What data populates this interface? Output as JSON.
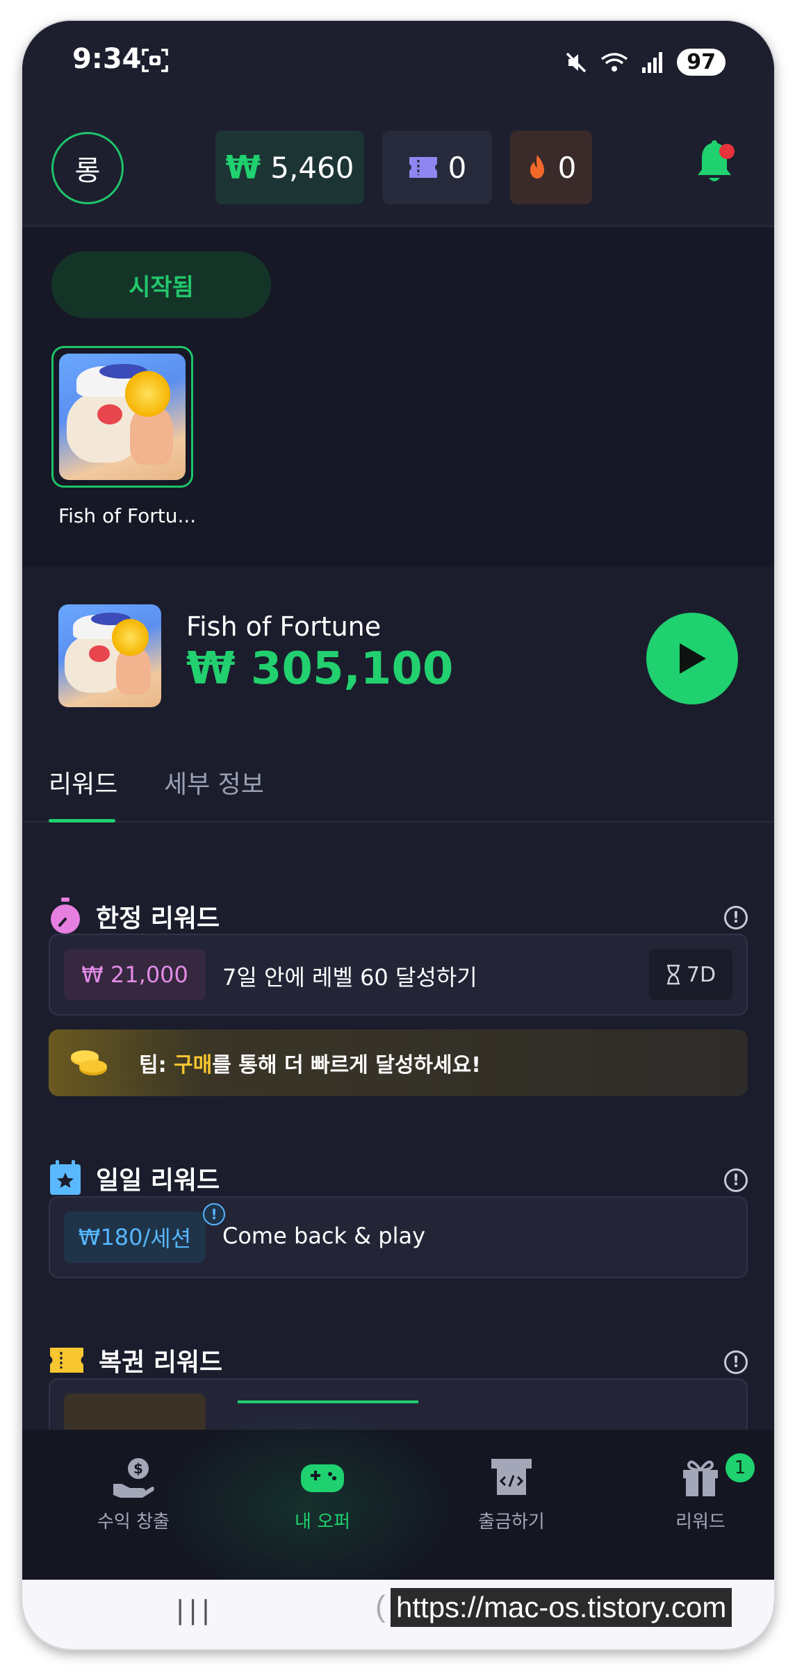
{
  "status": {
    "time": "9:34",
    "battery": "97"
  },
  "header": {
    "avatar_text": "롱",
    "coins": {
      "symbol": "₩",
      "value": "5,460"
    },
    "tickets": "0",
    "fire": "0"
  },
  "started": {
    "label": "시작됨",
    "games": [
      {
        "name": "Fish of Fortu..."
      }
    ]
  },
  "game": {
    "name": "Fish of Fortune",
    "currency": "₩",
    "amount": "305,100"
  },
  "tabs": [
    {
      "label": "리워드",
      "active": true
    },
    {
      "label": "세부 정보",
      "active": false
    }
  ],
  "limited": {
    "title": "한정 리워드",
    "reward": "₩ 21,000",
    "task": "7일 안에 레벨 60 달성하기",
    "days": "7D"
  },
  "tip": {
    "prefix": "팁: ",
    "highlight": "구매",
    "rest": "를 통해 더 빠르게 달성하세요!"
  },
  "daily": {
    "title": "일일 리워드",
    "reward_amount": "₩180",
    "reward_sep": " / ",
    "reward_unit": "세션",
    "task": "Come back & play"
  },
  "lottery": {
    "title": "복권 리워드"
  },
  "nav": [
    {
      "label": "수익 창출",
      "icon": "money-hand-icon",
      "active": false
    },
    {
      "label": "내 오퍼",
      "icon": "gamepad-icon",
      "active": true
    },
    {
      "label": "출금하기",
      "icon": "withdraw-icon",
      "active": false
    },
    {
      "label": "리워드",
      "icon": "gift-icon",
      "active": false,
      "badge": "1"
    }
  ],
  "system": {
    "recents": "|||",
    "watermark": "https://mac-os.tistory.com"
  },
  "colors": {
    "accent": "#1fd16f",
    "background": "#1b1d2c",
    "pink": "#e38be6",
    "blue": "#56b6ff",
    "gold": "#f8c630"
  }
}
